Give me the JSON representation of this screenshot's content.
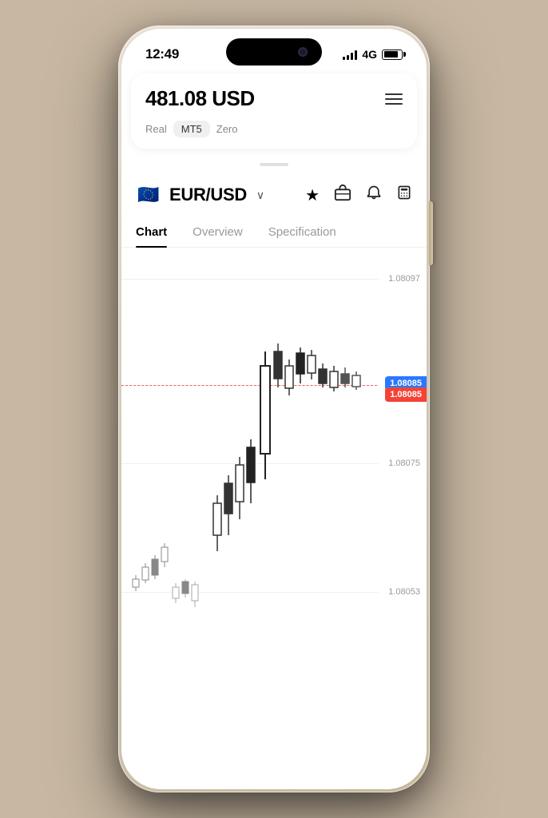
{
  "phone": {
    "status": {
      "time": "12:49",
      "network": "4G"
    },
    "header": {
      "balance": "481.08 USD",
      "menu_label": "menu",
      "accounts": [
        {
          "label": "Real",
          "active": false
        },
        {
          "label": "MT5",
          "active": true
        },
        {
          "label": "Zero",
          "active": false
        }
      ]
    },
    "pair": {
      "name": "EUR/USD",
      "flag": "🇪🇺",
      "chevron": "∨"
    },
    "icons": {
      "star": "★",
      "briefcase": "💼",
      "bell": "🔔",
      "calculator": "🧮"
    },
    "tabs": [
      {
        "label": "Chart",
        "active": true
      },
      {
        "label": "Overview",
        "active": false
      },
      {
        "label": "Specification",
        "active": false
      }
    ],
    "chart": {
      "price_levels": [
        {
          "value": "1.08097",
          "y_pct": 8
        },
        {
          "value": "1.08085",
          "y_pct": 35
        },
        {
          "value": "1.08075",
          "y_pct": 55
        },
        {
          "value": "1.08053",
          "y_pct": 88
        }
      ],
      "ask_price": "1.08085",
      "bid_price": "1.08085"
    }
  }
}
